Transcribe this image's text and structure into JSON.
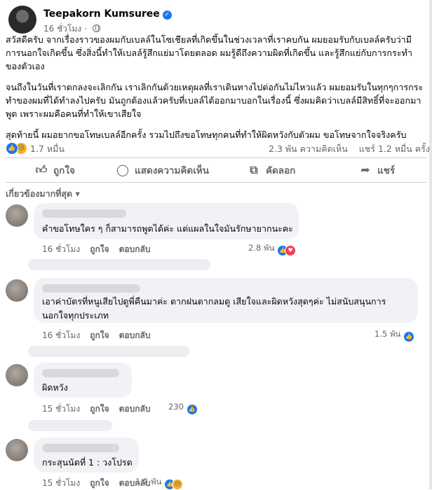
{
  "post": {
    "author": "Teepakorn Kumsuree",
    "time": "16 ชั่วโมง",
    "paragraphs": [
      "สวัสดีครับ จากเรื่องราวของผมกับเบลล์ในโซเชียลที่เกิดขึ้นในช่วงเวลาที่เราคบกัน ผมยอมรับกับเบลล์ครับว่ามีการนอกใจเกิดขึ้น ซึ่งสิ่งนี้ทำให้เบลล์รู้สึกแย่มาโดยตลอด ผมรู้ดีถึงความผิดที่เกิดขึ้น และรู้สึกแย่กับการกระทำของตัวเอง",
      "จนถึงในวันที่เราตกลงจะเลิกกัน เราเลิกกันด้วยเหตุผลที่เราเดินทางไปต่อกันไม่ไหวแล้ว ผมยอมรับในทุกๆการกระทำของผมที่ได้ทำลงไปครับ มันถูกต้องแล้วครับที่เบลล์ได้ออกมาบอกในเรื่องนี้ ซึ่งผมคิดว่าเบลล์มีสิทธิ์ที่จะออกมาพูด เพราะผมคือคนที่ทำให้เขาเสียใจ",
      "สุดท้ายนี้ ผมอยากขอโทษเบลล์อีกครั้ง รวมไปถึงขอโทษทุกคนที่ทำให้ผิดหวังกับตัวผม ขอโทษจากใจจริงครับ"
    ],
    "reaction_count": "1.7 หมื่น",
    "comment_count": "2.3 พัน ความคิดเห็น",
    "share_count": "แชร์ 1.2 หมื่น ครั้ง"
  },
  "actions": {
    "like": "ถูกใจ",
    "comment": "แสดงความคิดเห็น",
    "copy": "คัดลอก",
    "share": "แชร์"
  },
  "sort_label": "เกี่ยวข้องมากที่สุด",
  "comments": [
    {
      "text": "คำขอโทษใคร ๆ ก็สามารถพูดได้ค่ะ แต่แผลในใจมันรักษายากนะคะ",
      "time": "16 ชั่วโมง",
      "like": "ถูกใจ",
      "reply": "ตอบกลับ",
      "reactions": "2.8 พัน"
    },
    {
      "text": "เอาค่าบัตรที่หนูเสียไปดูพี่คืนมาค่ะ ตากฝนตากลมดู เสียใจและผิดหวังสุดๆค่ะ ไม่สนับสนุนการนอกใจทุกประเภท",
      "time": "16 ชั่วโมง",
      "like": "ถูกใจ",
      "reply": "ตอบกลับ",
      "reactions": "1.5 พัน"
    },
    {
      "text": "ผิดหวัง",
      "time": "15 ชั่วโมง",
      "like": "ถูกใจ",
      "reply": "ตอบกลับ",
      "reactions": "230"
    },
    {
      "text": "กระสุนนัดที่ 1 : วงโปรด",
      "time": "15 ชั่วโมง",
      "like": "ถูกใจ",
      "reply": "ตอบกลับ",
      "reactions": "1.2 พัน"
    }
  ],
  "colors": {
    "accent": "#1877f2",
    "muted": "#65676b",
    "bubble": "#f0f2f5"
  }
}
